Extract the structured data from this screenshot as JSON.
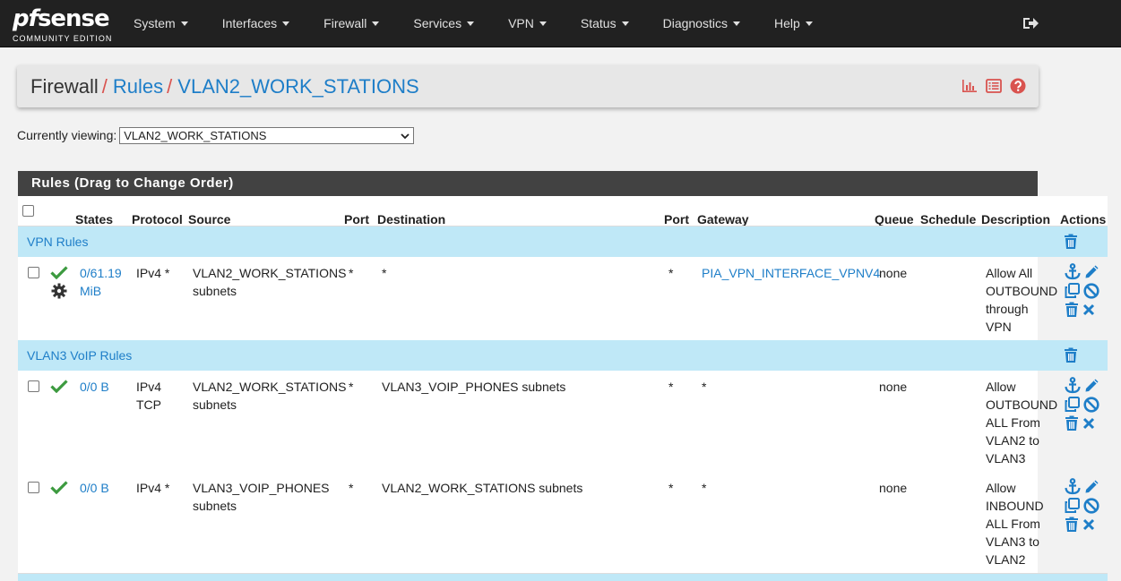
{
  "brand": {
    "name_pf": "pf",
    "name_rest": "sense",
    "edition": "COMMUNITY EDITION"
  },
  "nav": {
    "items": [
      "System",
      "Interfaces",
      "Firewall",
      "Services",
      "VPN",
      "Status",
      "Diagnostics",
      "Help"
    ]
  },
  "breadcrumb": {
    "root": "Firewall",
    "sep": "/",
    "rules": "Rules",
    "current": "VLAN2_WORK_STATIONS"
  },
  "viewing": {
    "label": "Currently viewing:",
    "selected": "VLAN2_WORK_STATIONS"
  },
  "panel": {
    "title": "Rules (Drag to Change Order)"
  },
  "columns": {
    "states": "States",
    "protocol": "Protocol",
    "source": "Source",
    "port": "Port",
    "destination": "Destination",
    "dport": "Port",
    "gateway": "Gateway",
    "queue": "Queue",
    "schedule": "Schedule",
    "description": "Description",
    "actions": "Actions"
  },
  "separators": [
    {
      "label": "VPN Rules"
    },
    {
      "label": "VLAN3 VoIP Rules"
    }
  ],
  "rules": [
    {
      "states": "0/61.19 MiB",
      "protocol": "IPv4 *",
      "source": "VLAN2_WORK_STATIONS subnets",
      "port": "*",
      "destination": "*",
      "dport": "*",
      "gateway": "PIA_VPN_INTERFACE_VPNV4",
      "queue": "none",
      "schedule": "",
      "description": "Allow All OUTBOUND through VPN"
    },
    {
      "states": "0/0 B",
      "protocol": "IPv4 TCP",
      "source": "VLAN2_WORK_STATIONS subnets",
      "port": "*",
      "destination": "VLAN3_VOIP_PHONES subnets",
      "dport": "*",
      "gateway": "*",
      "queue": "none",
      "schedule": "",
      "description": "Allow OUTBOUND ALL From VLAN2 to VLAN3"
    },
    {
      "states": "0/0 B",
      "protocol": "IPv4 *",
      "source": "VLAN3_VOIP_PHONES subnets",
      "port": "*",
      "destination": "VLAN2_WORK_STATIONS subnets",
      "dport": "*",
      "gateway": "*",
      "queue": "none",
      "schedule": "",
      "description": "Allow INBOUND ALL From VLAN3 to VLAN2"
    }
  ],
  "colors": {
    "accent": "#1e7ec8",
    "pass": "#3c9a3f",
    "separator_bg": "#bfe8f7",
    "danger": "#d9534f"
  }
}
